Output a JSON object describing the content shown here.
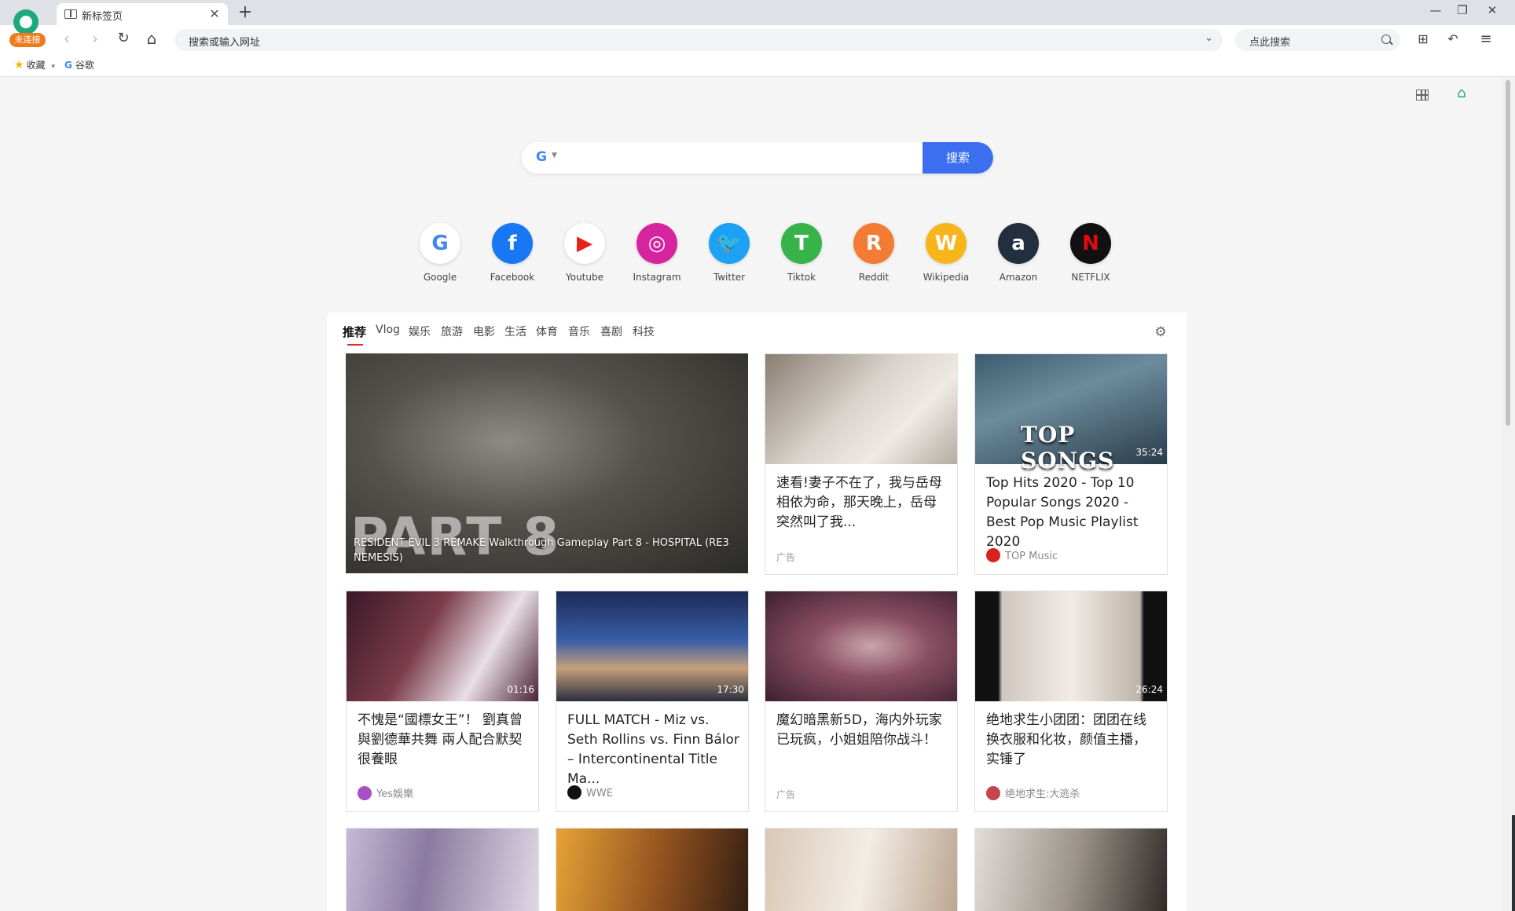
{
  "browser": {
    "profile_badge": "未连接",
    "tab_title": "新标签页",
    "tab_close": "✕",
    "new_tab": "+",
    "window_controls": {
      "minimize": "—",
      "restore": "❐",
      "close": "✕"
    },
    "address_placeholder": "搜索或输入网址",
    "search_placeholder": "点此搜索",
    "nav": {
      "back": "‹",
      "forward": "›",
      "reload": "↻",
      "home": "⌂"
    },
    "bookmarks": [
      {
        "label": "收藏"
      },
      {
        "label": "谷歌"
      }
    ]
  },
  "search": {
    "engine": "G",
    "button": "搜索"
  },
  "shortcuts": [
    {
      "label": "Google",
      "glyph": "G",
      "color": "#ffffff",
      "fg": "#4285f4"
    },
    {
      "label": "Facebook",
      "glyph": "f",
      "color": "#1877f2",
      "fg": "#ffffff"
    },
    {
      "label": "Youtube",
      "glyph": "▶",
      "color": "#ffffff",
      "fg": "#e62117"
    },
    {
      "label": "Instagram",
      "glyph": "◎",
      "color": "#d6249f",
      "fg": "#ffffff"
    },
    {
      "label": "Twitter",
      "glyph": "🐦",
      "color": "#1da1f2",
      "fg": "#ffffff"
    },
    {
      "label": "Tiktok",
      "glyph": "T",
      "color": "#37b34a",
      "fg": "#ffffff"
    },
    {
      "label": "Reddit",
      "glyph": "R",
      "color": "#f47b34",
      "fg": "#ffffff"
    },
    {
      "label": "Wikipedia",
      "glyph": "W",
      "color": "#f7b51c",
      "fg": "#ffffff"
    },
    {
      "label": "Amazon",
      "glyph": "a",
      "color": "#232f3e",
      "fg": "#ffffff"
    },
    {
      "label": "NETFLIX",
      "glyph": "N",
      "color": "#111111",
      "fg": "#e50914"
    }
  ],
  "categories": [
    "推荐",
    "Vlog",
    "娱乐",
    "旅游",
    "电影",
    "生活",
    "体育",
    "音乐",
    "喜剧",
    "科技"
  ],
  "cards": {
    "featured": {
      "title": "RESIDENT EVIL 3 REMAKE Walkthrough Gameplay Part 8 - HOSPITAL (RE3 NEMESIS)",
      "overlay": "PART 8"
    },
    "c1": {
      "title": "速看!妻子不在了，我与岳母相依为命，那天晚上，岳母突然叫了我...",
      "ad": "广告"
    },
    "c2": {
      "title": "Top Hits 2020 - Top 10 Popular Songs 2020 - Best Pop Music Playlist 2020",
      "duration": "35:24",
      "source": "TOP Music",
      "overlay": "TOP SONGS"
    },
    "c3": {
      "title": "不愧是“國標女王”！ 劉真曾與劉德華共舞 兩人配合默契很養眼",
      "duration": "01:16",
      "source": "Yes娛樂"
    },
    "c4": {
      "title": "FULL MATCH - Miz vs. Seth Rollins vs. Finn Bálor – Intercontinental Title Ma...",
      "duration": "17:30",
      "source": "WWE"
    },
    "c5": {
      "title": "魔幻暗黑新5D，海内外玩家已玩疯，小姐姐陪你战斗！",
      "ad": "广告"
    },
    "c6": {
      "title": "绝地求生小团团：团团在线换衣服和化妆，颜值主播，实锤了",
      "duration": "26:24",
      "source": "绝地求生:大逃杀"
    }
  }
}
